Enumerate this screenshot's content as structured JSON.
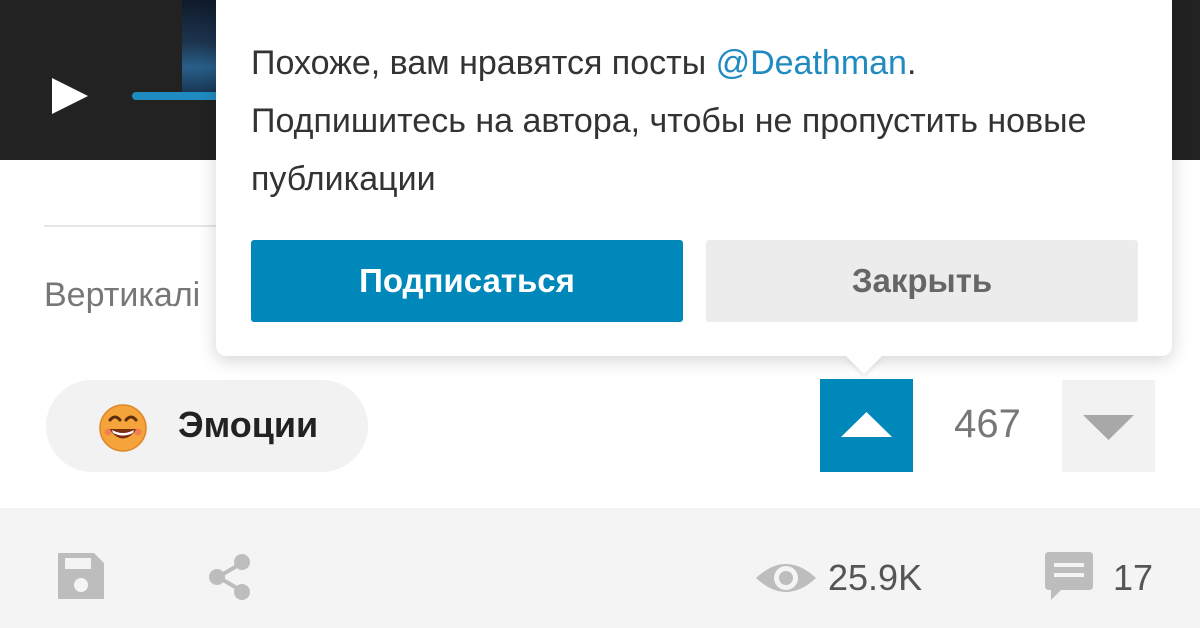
{
  "popup": {
    "text_before": "Похоже, вам нравятся посты ",
    "mention": "@Deathman",
    "text_after": ". Подпишитесь на автора, чтобы не пропустить новые публикации",
    "subscribe_label": "Подписаться",
    "close_label": "Закрыть"
  },
  "content": {
    "truncated_text": "Вертикалі"
  },
  "emotions": {
    "label": "Эмоции",
    "icon": "smiling-emoji-icon"
  },
  "votes": {
    "count": "467"
  },
  "footer": {
    "views": "25.9K",
    "comments": "17"
  },
  "colors": {
    "accent": "#0088bb",
    "mention": "#1f8bc0",
    "player_bg": "#222222"
  }
}
